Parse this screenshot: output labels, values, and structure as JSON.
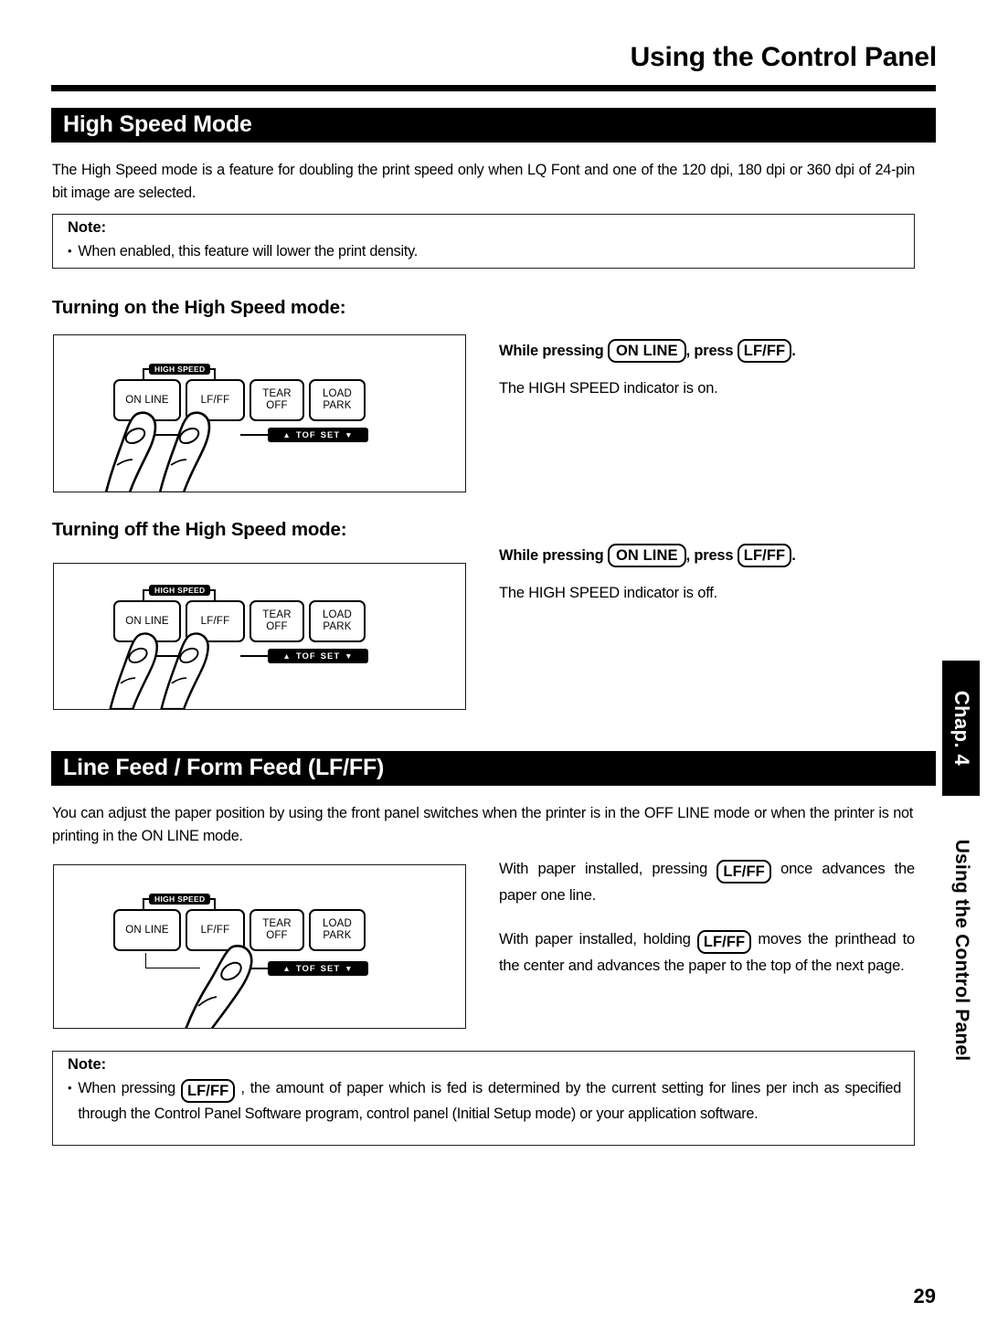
{
  "header": {
    "title": "Using the Control Panel"
  },
  "sections": {
    "high_speed": {
      "bar_label": "High Speed Mode",
      "intro": "The High Speed mode is a feature for doubling the print speed only when LQ Font and one of the 120 dpi, 180 dpi or 360 dpi of 24-pin bit image are selected.",
      "note": {
        "label": "Note:",
        "bullet": "•",
        "text": "When enabled, this feature will lower the print density."
      },
      "turning_on": {
        "heading": "Turning on the High Speed mode:",
        "instruction_prefix": "While pressing",
        "key1": "ON LINE",
        "instruction_middle": ", press",
        "key2": "LF/FF",
        "instruction_suffix": ".",
        "result": "The HIGH SPEED indicator is on."
      },
      "turning_off": {
        "heading": "Turning off the High Speed mode:",
        "instruction_prefix": "While pressing",
        "key1": "ON LINE",
        "instruction_middle": ", press",
        "key2": "LF/FF",
        "instruction_suffix": ".",
        "result": "The HIGH SPEED indicator is off."
      }
    },
    "line_feed": {
      "bar_label": "Line Feed / Form Feed (LF/FF)",
      "intro": "You can adjust the paper position by using the front panel switches when the printer is in the OFF LINE mode or when the printer is not printing in the ON LINE mode.",
      "para1_a": "With paper installed, pressing",
      "para1_key": "LF/FF",
      "para1_b": "once advances the paper one line.",
      "para2_a": "With paper installed, holding",
      "para2_key": "LF/FF",
      "para2_b": "moves the printhead to the center and advances the paper to the top of the next page.",
      "note": {
        "label": "Note:",
        "bullet": "•",
        "text_a": "When pressing",
        "key": "LF/FF",
        "text_b": ", the amount of paper which is fed is determined by the current setting for lines per inch as specified through the Control Panel Software program, control panel (Initial Setup mode) or your application software."
      }
    }
  },
  "control_panel": {
    "high_speed_label": "HIGH SPEED",
    "buttons": [
      {
        "line1": "ON LINE",
        "line2": ""
      },
      {
        "line1": "LF/FF",
        "line2": ""
      },
      {
        "line1": "TEAR",
        "line2": "OFF"
      },
      {
        "line1": "LOAD",
        "line2": "PARK"
      }
    ],
    "tof_bar": {
      "up_triangle": "▲",
      "label_1": "TOF",
      "label_2": "SET",
      "down_triangle": "▼"
    }
  },
  "chapter_tab": {
    "tab_label": "Chap. 4",
    "side_label": "Using the Control Panel"
  },
  "footer": {
    "page_number": "29"
  },
  "colors": {
    "ink": "#000000",
    "paper": "#ffffff"
  }
}
